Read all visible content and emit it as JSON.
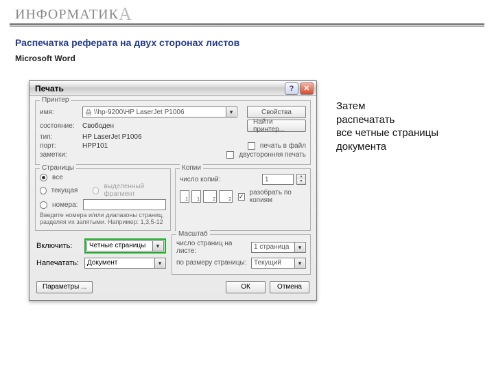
{
  "brand": {
    "text": "ИНФОРМАТИК",
    "last": "А"
  },
  "heading": "Распечатка реферата на двух сторонах листов",
  "subheading": "Microsoft Word",
  "note": "Затем\nраспечатать\nвсе четные страницы\nдокумента",
  "dialog": {
    "title": "Печать",
    "printer": {
      "legend": "Принтер",
      "name_lbl": "имя:",
      "name_val": "\\\\hp-9200\\HP LaserJet P1006",
      "state_lbl": "состояние:",
      "state_val": "Свободен",
      "type_lbl": "тип:",
      "type_val": "HP LaserJet P1006",
      "port_lbl": "порт:",
      "port_val": "HPP101",
      "notes_lbl": "заметки:",
      "props_btn": "Свойства",
      "find_btn": "Найти принтер...",
      "to_file_chk": "печать в файл",
      "duplex_chk": "двусторонняя печать"
    },
    "pages": {
      "legend": "Страницы",
      "all": "все",
      "current": "текущая",
      "selection": "выделенный фрагмент",
      "numbers": "номера:",
      "hint": "Введите номера и/или диапазоны страниц, разделяя их запятыми. Например: 1,3,5-12"
    },
    "copies": {
      "legend": "Копии",
      "count_lbl": "число копий:",
      "count_val": "1",
      "collate": "разобрать по копиям"
    },
    "include_lbl": "Включить:",
    "include_val": "Четные страницы",
    "print_lbl": "Напечатать:",
    "print_val": "Документ",
    "scale": {
      "legend": "Масштаб",
      "pps_lbl": "число страниц на листе:",
      "pps_val": "1 страница",
      "fit_lbl": "по размеру страницы:",
      "fit_val": "Текущий"
    },
    "params_btn": "Параметры ...",
    "ok_btn": "ОК",
    "cancel_btn": "Отмена"
  }
}
